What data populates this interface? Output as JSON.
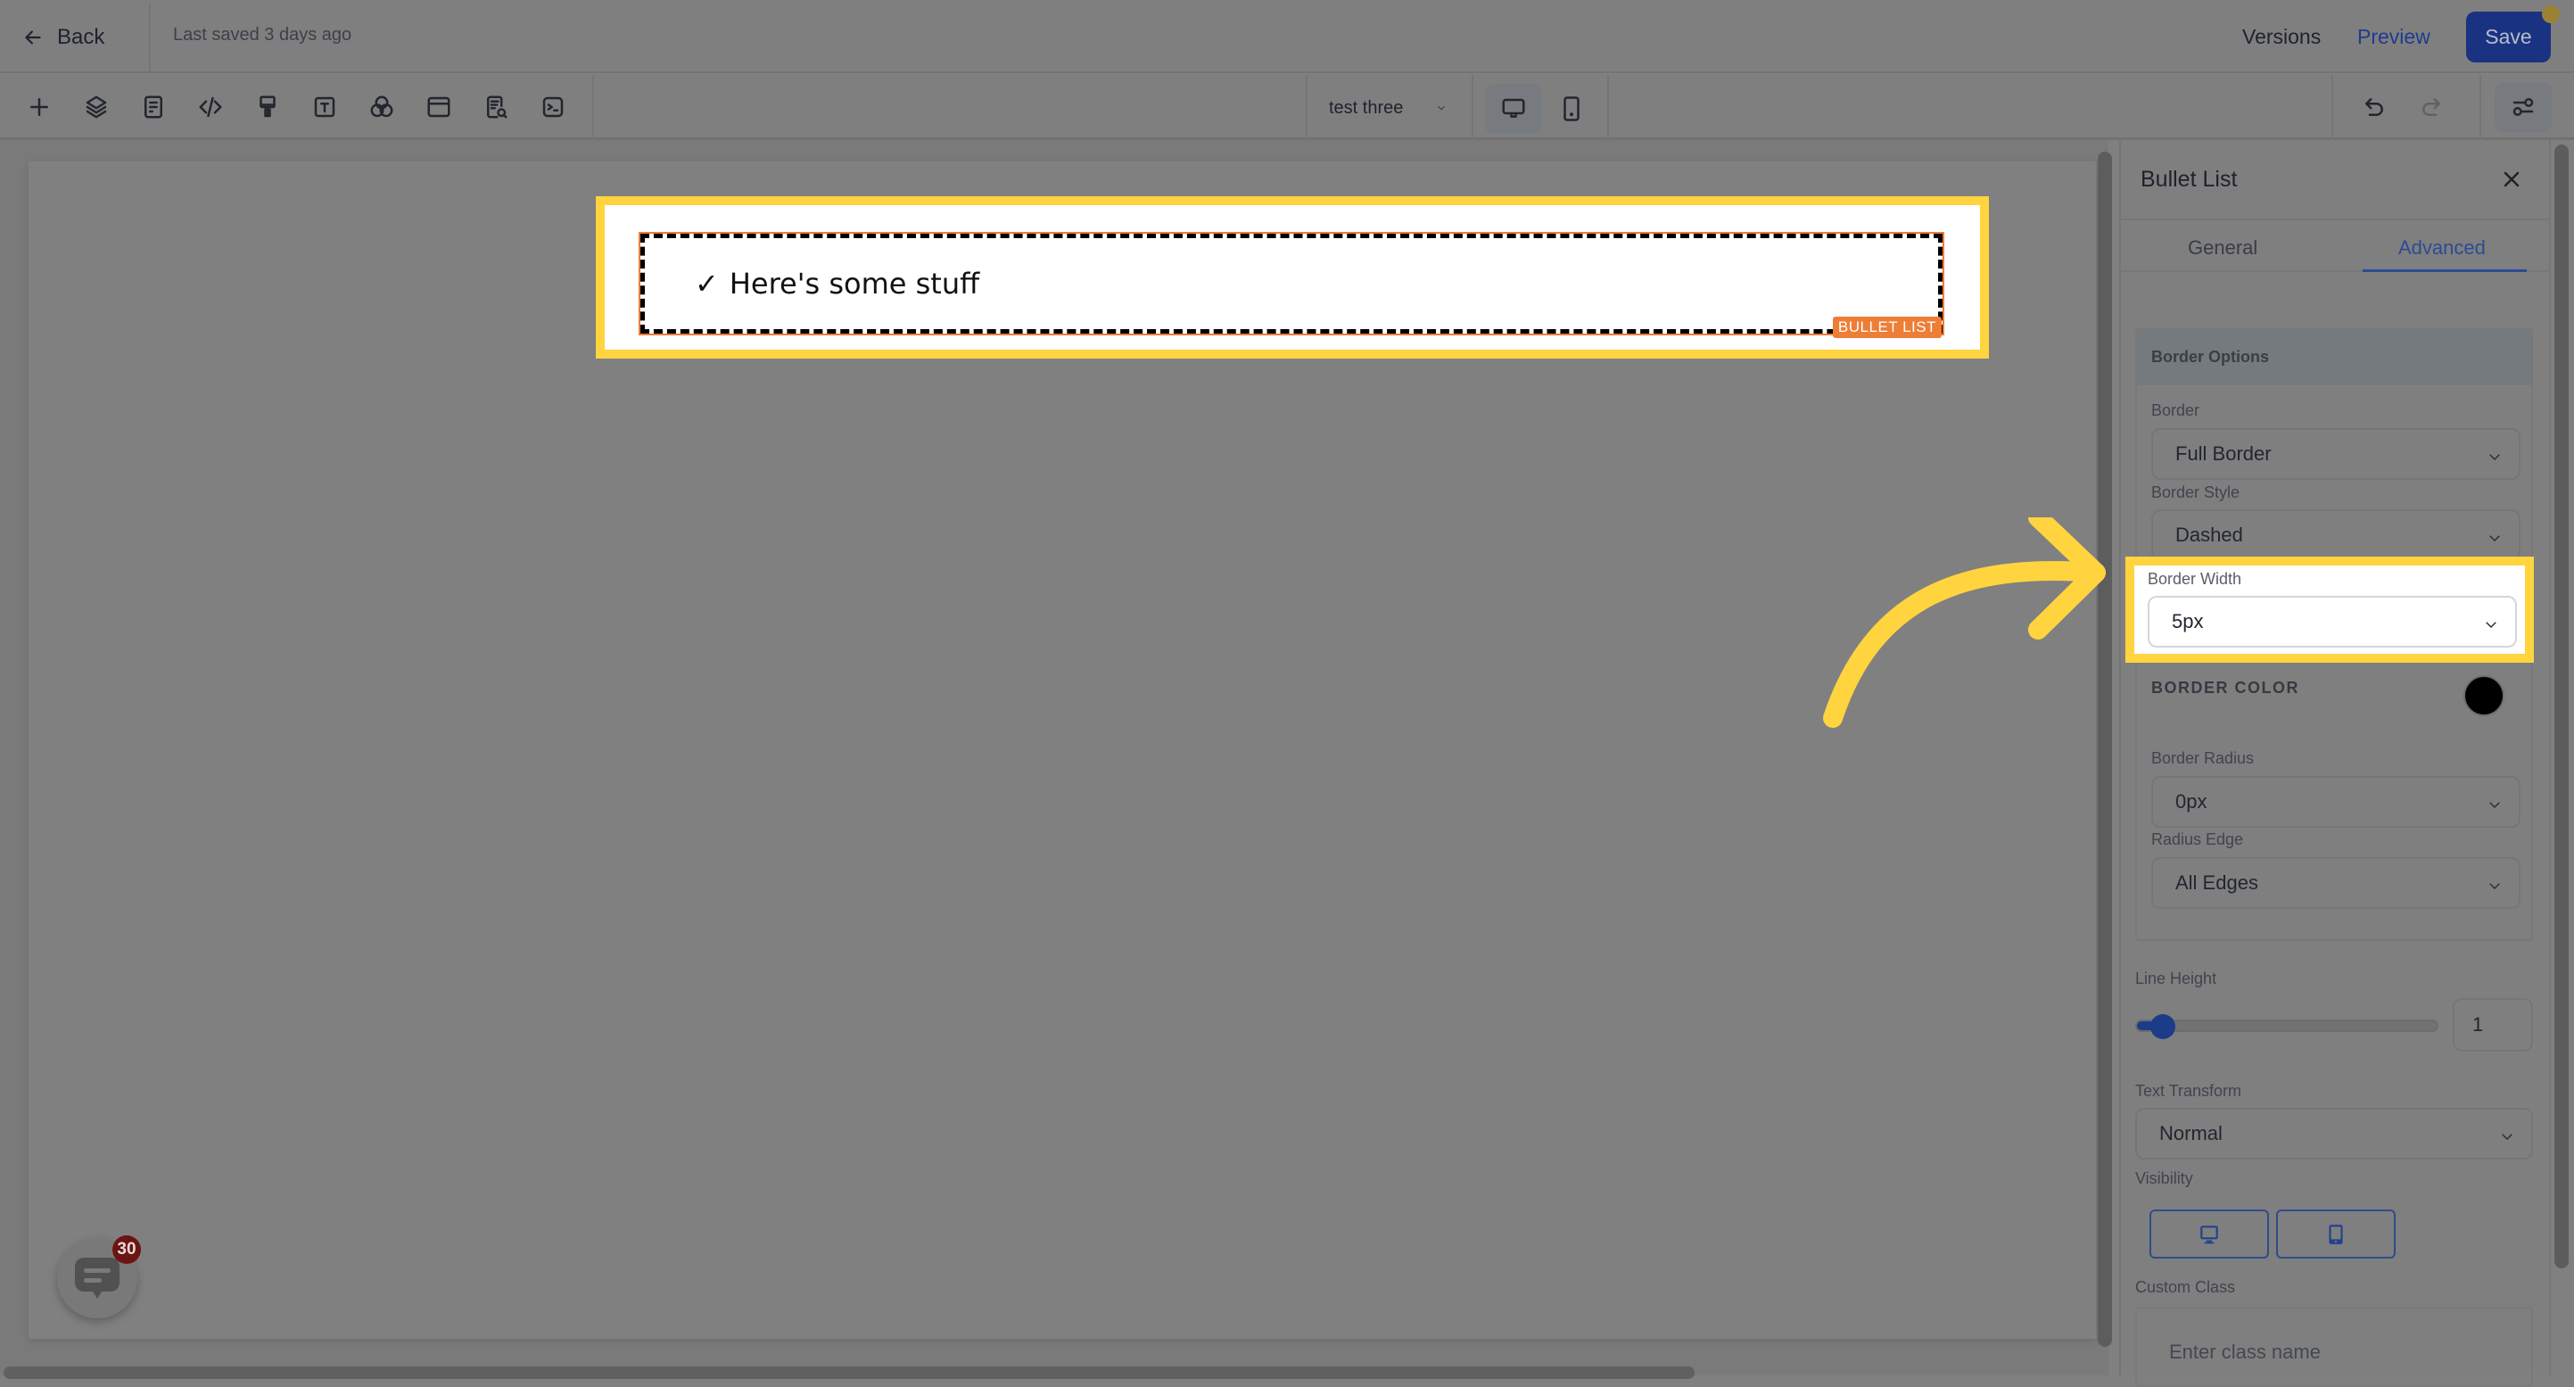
{
  "topbar": {
    "back_label": "Back",
    "last_saved": "Last saved 3 days ago",
    "versions_label": "Versions",
    "preview_label": "Preview",
    "save_label": "Save"
  },
  "toolbar": {
    "tools": [
      "add",
      "layers",
      "pages",
      "custom-code",
      "styles",
      "text-typography",
      "colors",
      "section-layout",
      "seo-search",
      "tracking-code"
    ],
    "page_selector": "test three",
    "device_modes": [
      "desktop",
      "mobile"
    ],
    "active_device": "desktop"
  },
  "canvas": {
    "element_tag": "BULLET LIST",
    "bullet_items": [
      {
        "icon": "✓",
        "text": "Here's some stuff"
      }
    ]
  },
  "chat_widget": {
    "badge_count": "30"
  },
  "panel": {
    "title": "Bullet List",
    "tabs": [
      {
        "label": "General",
        "active": false
      },
      {
        "label": "Advanced",
        "active": true
      }
    ],
    "border_options": {
      "title": "Border Options",
      "border": {
        "label": "Border",
        "value": "Full Border"
      },
      "border_style": {
        "label": "Border Style",
        "value": "Dashed"
      },
      "border_width": {
        "label": "Border Width",
        "value": "5px"
      },
      "border_color": {
        "label": "BORDER COLOR",
        "value": "#000000"
      },
      "border_radius": {
        "label": "Border Radius",
        "value": "0px"
      },
      "radius_edge": {
        "label": "Radius Edge",
        "value": "All Edges"
      }
    },
    "line_height": {
      "label": "Line Height",
      "value": "1",
      "slider_fraction": 0.04
    },
    "text_transform": {
      "label": "Text Transform",
      "value": "Normal"
    },
    "visibility": {
      "label": "Visibility",
      "options": [
        "desktop",
        "mobile"
      ]
    },
    "custom_class": {
      "label": "Custom Class",
      "placeholder": "Enter class name"
    }
  },
  "colors": {
    "accent": "#1a3282",
    "highlight": "#ffd43f",
    "element_outline": "#ee7d36",
    "chat_badge": "#6b1512"
  }
}
